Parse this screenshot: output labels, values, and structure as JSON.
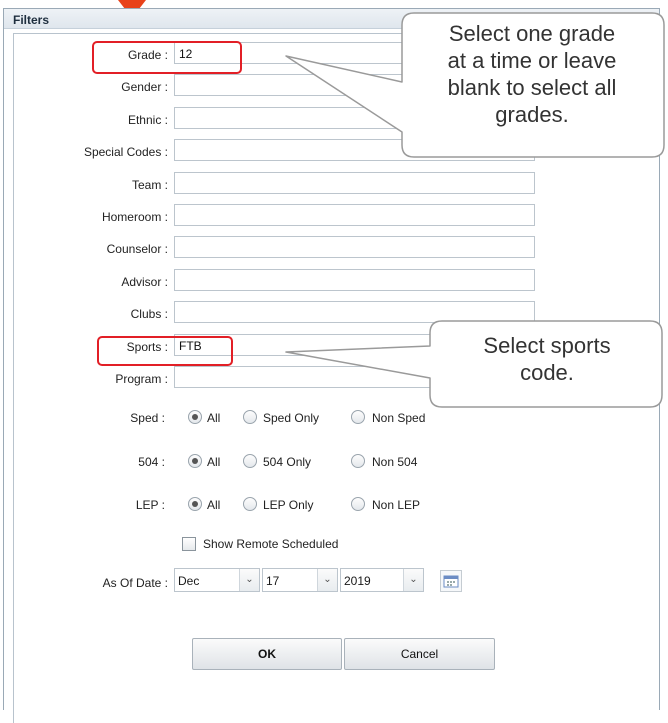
{
  "dialog": {
    "title": "Filters"
  },
  "fields": [
    {
      "key": "grade",
      "label": "Grade :",
      "value": "12"
    },
    {
      "key": "gender",
      "label": "Gender :",
      "value": ""
    },
    {
      "key": "ethnic",
      "label": "Ethnic :",
      "value": ""
    },
    {
      "key": "special_codes",
      "label": "Special Codes :",
      "value": ""
    },
    {
      "key": "team",
      "label": "Team :",
      "value": ""
    },
    {
      "key": "homeroom",
      "label": "Homeroom :",
      "value": ""
    },
    {
      "key": "counselor",
      "label": "Counselor :",
      "value": ""
    },
    {
      "key": "advisor",
      "label": "Advisor :",
      "value": ""
    },
    {
      "key": "clubs",
      "label": "Clubs :",
      "value": ""
    },
    {
      "key": "sports",
      "label": "Sports :",
      "value": "FTB"
    },
    {
      "key": "program",
      "label": "Program :",
      "value": ""
    }
  ],
  "sped": {
    "label": "Sped :",
    "options": [
      "All",
      "Sped Only",
      "Non Sped"
    ],
    "selected": "All"
  },
  "s504": {
    "label": "504 :",
    "options": [
      "All",
      "504 Only",
      "Non 504"
    ],
    "selected": "All"
  },
  "lep": {
    "label": "LEP :",
    "options": [
      "All",
      "LEP Only",
      "Non LEP"
    ],
    "selected": "All"
  },
  "show_remote": {
    "label": "Show Remote Scheduled",
    "checked": false
  },
  "as_of_date": {
    "label": "As Of Date :",
    "month": "Dec",
    "day": "17",
    "year": "2019"
  },
  "buttons": {
    "ok": "OK",
    "cancel": "Cancel"
  },
  "callouts": {
    "grade": [
      "Select one grade",
      "at a time or leave",
      "blank to select all",
      "grades."
    ],
    "sports": [
      "Select sports",
      "code."
    ]
  },
  "colors": {
    "highlight": "#e21f26",
    "arrow": "#e8421a",
    "callout_border": "#9a9a9a"
  },
  "icons": {
    "calendar": "calendar-icon",
    "dropdown": "chevron-down-icon"
  }
}
